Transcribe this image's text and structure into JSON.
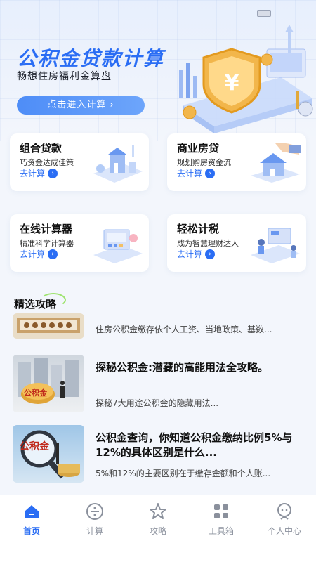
{
  "hero": {
    "title": "公积金贷款计算",
    "subtitle": "畅想住房福利金算盘",
    "button_label": "点击进入计算 ›"
  },
  "cards": [
    {
      "title": "组合贷款",
      "desc": "巧资金达成佳策",
      "link": "去计算",
      "icon": "house-building-icon"
    },
    {
      "title": "商业房贷",
      "desc": "规划购房资金流",
      "link": "去计算",
      "icon": "house-hand-icon"
    },
    {
      "title": "在线计算器",
      "desc": "精准科学计算器",
      "link": "去计算",
      "icon": "calculator-screen-icon"
    },
    {
      "title": "轻松计税",
      "desc": "成为智慧理财达人",
      "link": "去计算",
      "icon": "tax-people-icon"
    }
  ],
  "section": {
    "title": "精选攻略"
  },
  "articles": [
    {
      "title": "",
      "desc": "住房公积金缴存依个人工资、当地政策、基数..."
    },
    {
      "title": "探秘公积金:潜藏的高能用法全攻略。",
      "desc": "探秘7大用途公积金的隐藏用法..."
    },
    {
      "title": "公积金查询，你知道公积金缴纳比例5%与12%的具体区别是什么...",
      "desc": "5%和12%的主要区别在于缴存金额和个人账..."
    }
  ],
  "thumb_labels": [
    "公积金",
    "公积金"
  ],
  "tabs": [
    {
      "label": "首页",
      "icon": "home-icon",
      "active": true
    },
    {
      "label": "计算",
      "icon": "divide-icon",
      "active": false
    },
    {
      "label": "攻略",
      "icon": "star-icon",
      "active": false
    },
    {
      "label": "工具箱",
      "icon": "grid-icon",
      "active": false
    },
    {
      "label": "个人中心",
      "icon": "user-icon",
      "active": false
    }
  ],
  "colors": {
    "accent": "#2a6df4",
    "inactive": "#8a909c",
    "background": "#f3f6fc"
  }
}
